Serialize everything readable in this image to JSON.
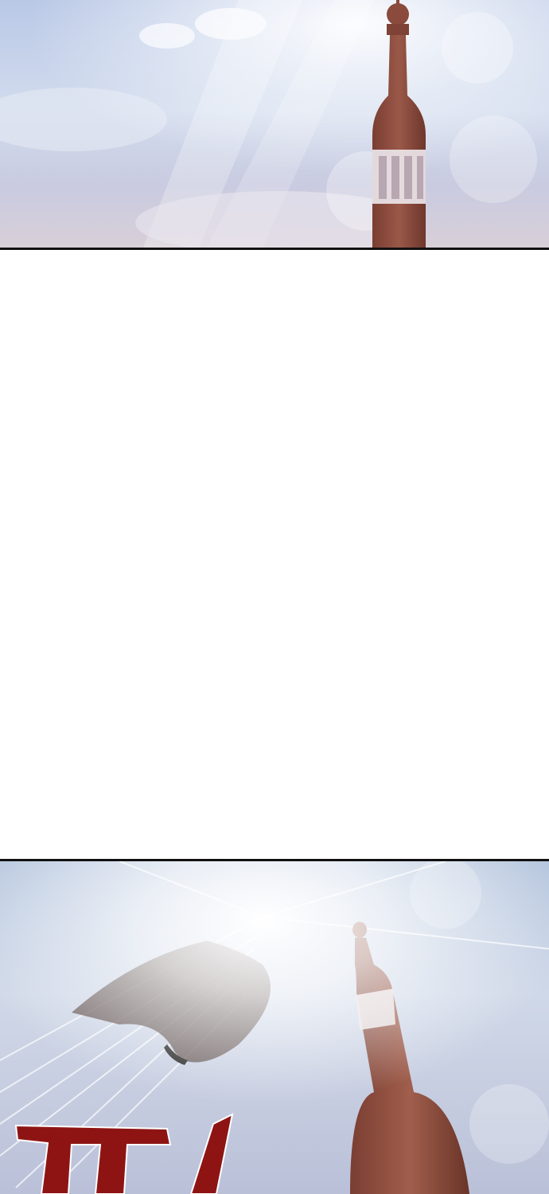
{
  "comic": {
    "panels": [
      {
        "id": "panel-1",
        "scene": "tower-sky"
      },
      {
        "id": "panel-2",
        "scene": "tower-impact"
      }
    ],
    "colors": {
      "tower": "#8a4a3c",
      "tower_band": "#e8e4e6",
      "sky": "#c4d2ea",
      "sfx_red": "#8e1414",
      "border": "#111111"
    }
  }
}
